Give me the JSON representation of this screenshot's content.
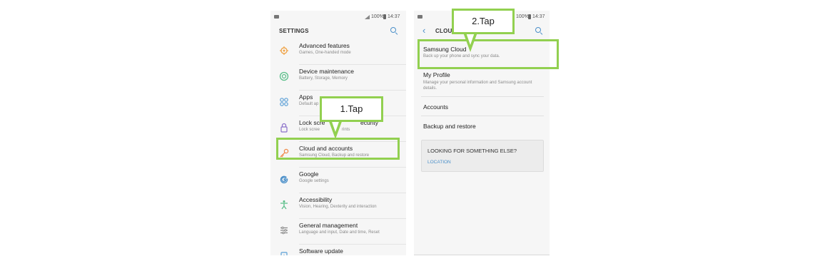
{
  "left_screen": {
    "status": {
      "signal_text": "",
      "battery_text": "100%",
      "time": "14:37"
    },
    "title": "SETTINGS",
    "items": [
      {
        "title": "Advanced features",
        "subtitle": "Games, One-handed mode",
        "icon": "advanced-features-icon"
      },
      {
        "title": "Device maintenance",
        "subtitle": "Battery, Storage, Memory",
        "icon": "device-maintenance-icon"
      },
      {
        "title": "Apps",
        "subtitle": "Default ap",
        "icon": "apps-icon"
      },
      {
        "title": "Lock scre",
        "title_tail": "ecurity",
        "subtitle": "Lock scree",
        "subtitle_tail": "rints",
        "icon": "lock-icon"
      },
      {
        "title": "Cloud and accounts",
        "subtitle": "Samsung Cloud, Backup and restore",
        "icon": "key-icon"
      },
      {
        "title": "Google",
        "subtitle": "Google settings",
        "icon": "google-icon"
      },
      {
        "title": "Accessibility",
        "subtitle": "Vision, Hearing, Dexterity and interaction",
        "icon": "accessibility-icon"
      },
      {
        "title": "General management",
        "subtitle": "Language and input, Date and time, Reset",
        "icon": "general-management-icon"
      },
      {
        "title": "Software update",
        "subtitle": "",
        "icon": "software-update-icon"
      }
    ]
  },
  "right_screen": {
    "status": {
      "battery_text": "100%",
      "time": "14:37"
    },
    "title": "CLOUD",
    "items": [
      {
        "title": "Samsung Cloud",
        "subtitle": "Back up your phone and sync your data."
      },
      {
        "title": "My Profile",
        "subtitle": "Manage your personal information and Samsung account details."
      },
      {
        "title": "Accounts",
        "subtitle": ""
      },
      {
        "title": "Backup and restore",
        "subtitle": ""
      }
    ],
    "looking_card": {
      "title": "LOOKING FOR SOMETHING ELSE?",
      "link": "LOCATION"
    }
  },
  "callouts": {
    "step1": "1.Tap",
    "step2": "2.Tap"
  },
  "colors": {
    "highlight": "#92d050",
    "accent": "#4a8fc9"
  }
}
